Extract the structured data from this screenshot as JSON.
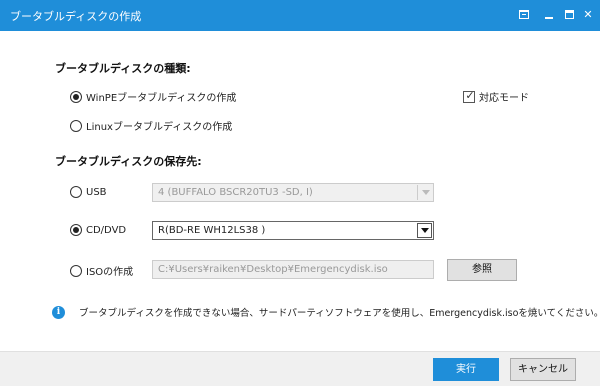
{
  "window": {
    "title": "ブータブルディスクの作成",
    "controls": {
      "menu_icon": "menu-icon",
      "minimize_icon": "minimize-icon",
      "maximize_icon": "maximize-icon",
      "close_glyph": "✕"
    }
  },
  "type_section": {
    "heading": "ブータブルディスクの種類:",
    "options": [
      {
        "label": "WinPEブータブルディスクの作成",
        "selected": true
      },
      {
        "label": "Linuxブータブルディスクの作成",
        "selected": false
      }
    ],
    "compat_mode": {
      "label": "対応モード",
      "checked": true
    }
  },
  "destination_section": {
    "heading": "ブータブルディスクの保存先:",
    "usb": {
      "label": "USB",
      "selected": false,
      "value": "4 (BUFFALO BSCR20TU3 -SD, I)"
    },
    "cd_dvd": {
      "label": "CD/DVD",
      "selected": true,
      "value": "R(BD-RE  WH12LS38 )"
    },
    "iso": {
      "label": "ISOの作成",
      "selected": false,
      "path": "C:¥Users¥raiken¥Desktop¥Emergencydisk.iso",
      "browse_label": "参照"
    }
  },
  "info": {
    "icon": "info-icon",
    "glyph": "i",
    "text": "ブータブルディスクを作成できない場合、サードパーティソフトウェアを使用し、Emergencydisk.isoを焼いてください。"
  },
  "footer": {
    "execute_label": "実行",
    "cancel_label": "キャンセル"
  },
  "colors": {
    "accent": "#1f8ed9"
  }
}
